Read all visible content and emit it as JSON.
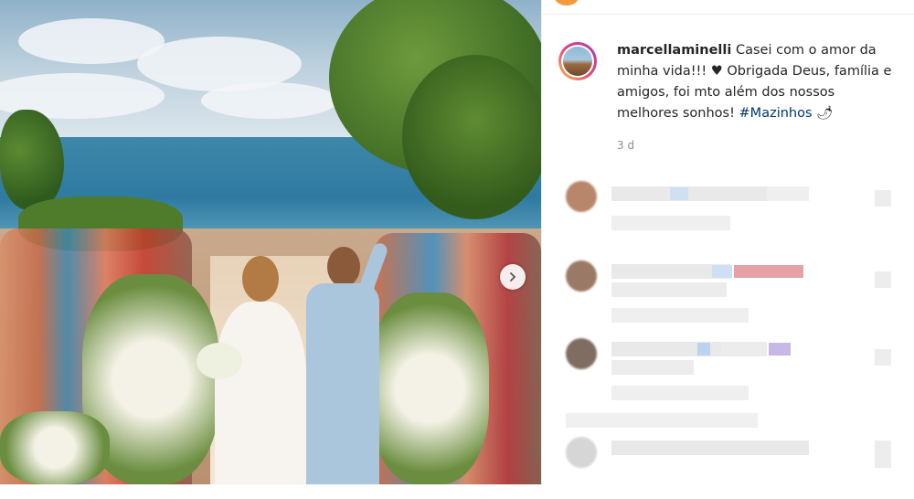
{
  "post": {
    "username": "marcellaminelli",
    "caption_text": "Casei com o amor da minha vida!!! ♥ Obrigada Deus, família e amigos, foi mto além dos nossos melhores sonhos!",
    "hashtag": "#Mazinhos",
    "emoji": "🌶",
    "timestamp": "3 d"
  },
  "icons": {
    "next": "chevron-right-icon",
    "avatar": "profile-avatar"
  },
  "colors": {
    "link": "#00376b",
    "text": "#262626",
    "muted": "#8e8e8e",
    "story_ring": "#e8407a"
  }
}
